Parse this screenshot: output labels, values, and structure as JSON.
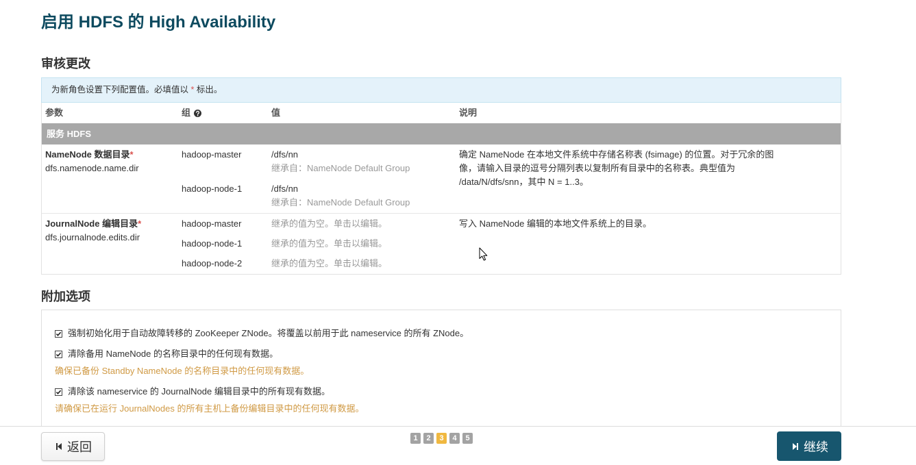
{
  "page": {
    "title": "启用 HDFS 的 High Availability"
  },
  "review": {
    "heading": "审核更改",
    "info": {
      "before": "为新角色设置下列配置值。必填值以 ",
      "asterisk": "*",
      "after": " 标出。"
    },
    "columns": {
      "param": "参数",
      "group": "组",
      "value": "值",
      "description": "说明"
    },
    "service_row": "服务 HDFS",
    "params": [
      {
        "label": "NameNode 数据目录",
        "required": "*",
        "key": "dfs.namenode.name.dir",
        "entries": [
          {
            "group": "hadoop-master",
            "value": "/dfs/nn",
            "inherit": "继承自：NameNode Default Group"
          },
          {
            "group": "hadoop-node-1",
            "value": "/dfs/nn",
            "inherit": "继承自：NameNode Default Group"
          }
        ],
        "description": "确定 NameNode 在本地文件系统中存储名称表 (fsimage) 的位置。对于冗余的图像，请输入目录的逗号分隔列表以复制所有目录中的名称表。典型值为 /data/N/dfs/snn，其中 N = 1..3。"
      },
      {
        "label": "JournalNode 编辑目录",
        "required": "*",
        "key": "dfs.journalnode.edits.dir",
        "entries": [
          {
            "group": "hadoop-master",
            "empty_value_prompt": "继承的值为空。单击以编辑。"
          },
          {
            "group": "hadoop-node-1",
            "empty_value_prompt": "继承的值为空。单击以编辑。"
          },
          {
            "group": "hadoop-node-2",
            "empty_value_prompt": "继承的值为空。单击以编辑。"
          }
        ],
        "description": "写入 NameNode 编辑的本地文件系统上的目录。"
      }
    ]
  },
  "options": {
    "heading": "附加选项",
    "items": [
      {
        "label": "强制初始化用于自动故障转移的 ZooKeeper ZNode。将覆盖以前用于此 nameservice 的所有 ZNode。",
        "checked": true
      },
      {
        "label": "清除备用 NameNode 的名称目录中的任何现有数据。",
        "checked": true,
        "warning": "确保已备份 Standby NameNode 的名称目录中的任何现有数据。"
      },
      {
        "label": "清除该 nameservice 的 JournalNode 编辑目录中的所有现有数据。",
        "checked": true,
        "warning": "请确保已在运行 JournalNodes 的所有主机上备份编辑目录中的任何现有数据。"
      }
    ]
  },
  "footer": {
    "back_label": "返回",
    "continue_label": "继续",
    "pages": [
      "1",
      "2",
      "3",
      "4",
      "5"
    ],
    "current_page": "3"
  },
  "icons": {
    "group_help": "question-circle-icon",
    "back": "step-backward-icon",
    "continue": "step-forward-icon",
    "checkbox": "checkbox-checked-icon",
    "pointer": "mouse-cursor-icon"
  },
  "colors": {
    "title": "#0d4a5f",
    "accent": "#17566e",
    "warning": "#d09a45",
    "required": "#d9534f",
    "active_page": "#f0b840",
    "page_box": "#a3a3a3",
    "service_row": "#a8a8a8",
    "info_bg": "#e4f2fa"
  }
}
